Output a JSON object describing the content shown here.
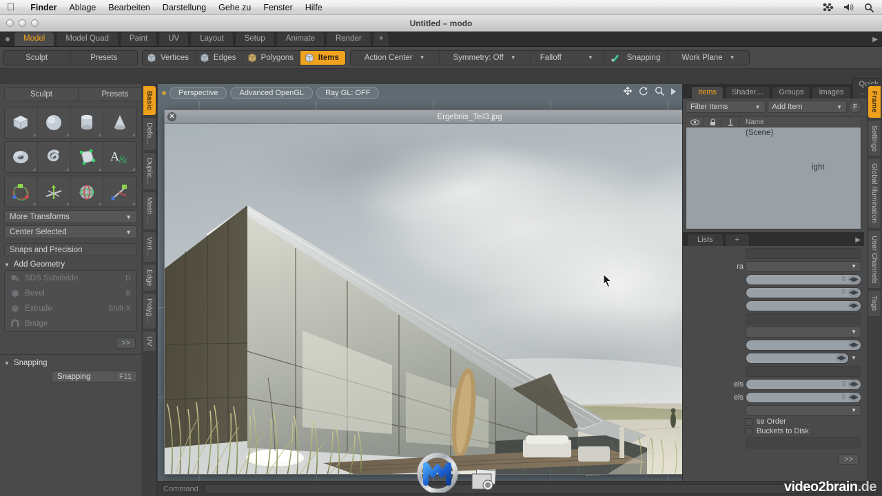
{
  "menubar": {
    "apple_icon": "apple-logo",
    "items": [
      {
        "label": "Finder",
        "bold": true
      },
      {
        "label": "Ablage",
        "bold": false
      },
      {
        "label": "Bearbeiten",
        "bold": false
      },
      {
        "label": "Darstellung",
        "bold": false
      },
      {
        "label": "Gehe zu",
        "bold": false
      },
      {
        "label": "Fenster",
        "bold": false
      },
      {
        "label": "Hilfe",
        "bold": false
      }
    ],
    "status_icons": [
      "spaces-icon",
      "volume-icon",
      "spotlight-search-icon"
    ]
  },
  "window": {
    "title": "Untitled – modo",
    "traffic_lights": [
      "close",
      "minimize",
      "zoom"
    ]
  },
  "tabstrip": {
    "tabs": [
      {
        "label": "Model",
        "active": true
      },
      {
        "label": "Model Quad",
        "active": false
      },
      {
        "label": "Paint",
        "active": false
      },
      {
        "label": "UV",
        "active": false
      },
      {
        "label": "Layout",
        "active": false
      },
      {
        "label": "Setup",
        "active": false
      },
      {
        "label": "Animate",
        "active": false
      },
      {
        "label": "Render",
        "active": false
      },
      {
        "label": "+",
        "active": false
      }
    ],
    "overflow_arrow": "chevron-right-icon"
  },
  "toolbar": {
    "left_group": [
      "Sculpt",
      "Presets"
    ],
    "modes": [
      {
        "label": "Vertices",
        "active": false
      },
      {
        "label": "Edges",
        "active": false
      },
      {
        "label": "Polygons",
        "active": false
      },
      {
        "label": "Items",
        "active": true
      }
    ],
    "options": [
      {
        "label": "Action Center",
        "dropdown": true
      },
      {
        "label": "Symmetry: Off",
        "dropdown": true
      },
      {
        "label": "Falloff",
        "dropdown": true
      },
      {
        "label": "Snapping",
        "dropdown": false,
        "icon": "snapping-icon"
      },
      {
        "label": "Work Plane",
        "dropdown": true
      }
    ]
  },
  "left_panel": {
    "top_buttons": [
      "Sculpt",
      "Presets"
    ],
    "tool_icons": [
      "cube-icon",
      "sphere-icon",
      "cylinder-icon",
      "cone-icon",
      "torus-icon",
      "spiral-icon",
      "polygon-pen-icon",
      "text-icon",
      "move-tool-icon",
      "rotate-tool-icon",
      "scale-tool-icon",
      "transform-tool-icon"
    ],
    "dropdowns": [
      "More Transforms",
      "Center Selected"
    ],
    "snaps_label": "Snaps and Precision",
    "add_geometry": {
      "title": "Add Geometry",
      "items": [
        {
          "label": "SDS Subdivide",
          "shortcut": "D",
          "icon": "sds-subdivide-icon"
        },
        {
          "label": "Bevel",
          "shortcut": "B",
          "icon": "bevel-icon"
        },
        {
          "label": "Extrude",
          "shortcut": "Shift-X",
          "icon": "extrude-icon"
        },
        {
          "label": "Bridge",
          "shortcut": "",
          "icon": "bridge-icon"
        }
      ],
      "more_button": ">>"
    },
    "snapping_section": {
      "title": "Snapping",
      "button_label": "Snapping",
      "shortcut": "F11"
    },
    "vertical_tabs": [
      {
        "label": "Basic",
        "active": true
      },
      {
        "label": "Defo…",
        "active": false
      },
      {
        "label": "Duplic…",
        "active": false
      },
      {
        "label": "Mesh …",
        "active": false
      },
      {
        "label": "Vert…",
        "active": false
      },
      {
        "label": "Edge",
        "active": false
      },
      {
        "label": "Polyg…",
        "active": false
      },
      {
        "label": "UV",
        "active": false
      }
    ]
  },
  "viewport": {
    "buttons": [
      "Perspective",
      "Advanced OpenGL",
      "Ray GL: OFF"
    ],
    "nav_icons": [
      "pan-icon",
      "rotate-icon",
      "zoom-icon",
      "play-icon"
    ],
    "scale_label": "10 m"
  },
  "image_window": {
    "title": "Ergebnis_Teil3.jpg",
    "close_icon": "close-icon",
    "content_description": "architectural exterior render of a modern gabled house with glass facade, dune grass and cloudy sky"
  },
  "right_panel": {
    "tabs": [
      {
        "label": "Items",
        "active": true
      },
      {
        "label": "Shader…",
        "active": false
      },
      {
        "label": "Groups",
        "active": false
      },
      {
        "label": "Images",
        "active": false
      },
      {
        "label": "Quick …",
        "active": false
      },
      {
        "label": "+",
        "active": false
      }
    ],
    "overflow_arrow": "chevron-right-icon",
    "filter_dropdown": "Filter Items",
    "add_item_dropdown": "Add Item",
    "filter_button": "F",
    "list_headers": [
      "eye-icon",
      "lock-icon",
      "render-icon",
      "Name"
    ],
    "list_rows": [
      "(Scene)",
      "ight"
    ],
    "lists_tabs": [
      {
        "label": "Lists",
        "active": false
      },
      {
        "label": "+",
        "active": false
      }
    ],
    "properties": [
      {
        "label": "ra",
        "type": "dropdown",
        "value": ""
      },
      {
        "label": "",
        "type": "field",
        "value": "0"
      },
      {
        "label": "",
        "type": "field",
        "value": "0"
      },
      {
        "label": "",
        "type": "field",
        "value": ""
      },
      {
        "label": "",
        "type": "blank",
        "value": ""
      },
      {
        "label": "",
        "type": "dropdown",
        "value": ""
      },
      {
        "label": "els",
        "type": "field",
        "value": "0"
      },
      {
        "label": "els",
        "type": "field",
        "value": "0"
      },
      {
        "label": "",
        "type": "field2",
        "value": ""
      },
      {
        "label": "",
        "type": "dropdown",
        "value": ""
      }
    ],
    "checkboxes": [
      "se Order",
      "Buckets to Disk"
    ],
    "more_button": ">>",
    "vertical_tabs": [
      {
        "label": "Frame",
        "active": true
      },
      {
        "label": "Settings",
        "active": false
      },
      {
        "label": "Global Illumination",
        "active": false
      },
      {
        "label": "User Channels",
        "active": false
      },
      {
        "label": "Tags",
        "active": false
      }
    ]
  },
  "status": {
    "command_label": "Command"
  },
  "dock": {
    "icons": [
      "modo-app-icon",
      "screenshot-camera-icon"
    ]
  },
  "watermark": {
    "brand": "video2brain",
    "tld": ".de"
  },
  "colors": {
    "accent": "#f0a21e",
    "panel": "#4a4a4a",
    "dark": "#2e2e2e",
    "viewport": "#6a747c"
  }
}
